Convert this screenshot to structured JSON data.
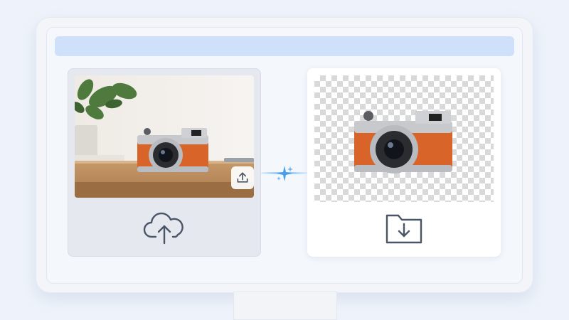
{
  "app": {
    "header_bar_text": "",
    "source_card": {
      "image_name": "camera-on-desk-photo",
      "corner_button_icon": "upload-icon",
      "bottom_icon": "cloud-upload-icon"
    },
    "connector_icon": "sparkle-icon",
    "result_card": {
      "image_name": "camera-transparent-cutout",
      "background": "transparency-checkerboard",
      "bottom_icon": "folder-download-icon"
    },
    "colors": {
      "accent_blue": "#cfe0fb",
      "camera_orange": "#d9642a",
      "icon_stroke": "#4a5566"
    }
  }
}
